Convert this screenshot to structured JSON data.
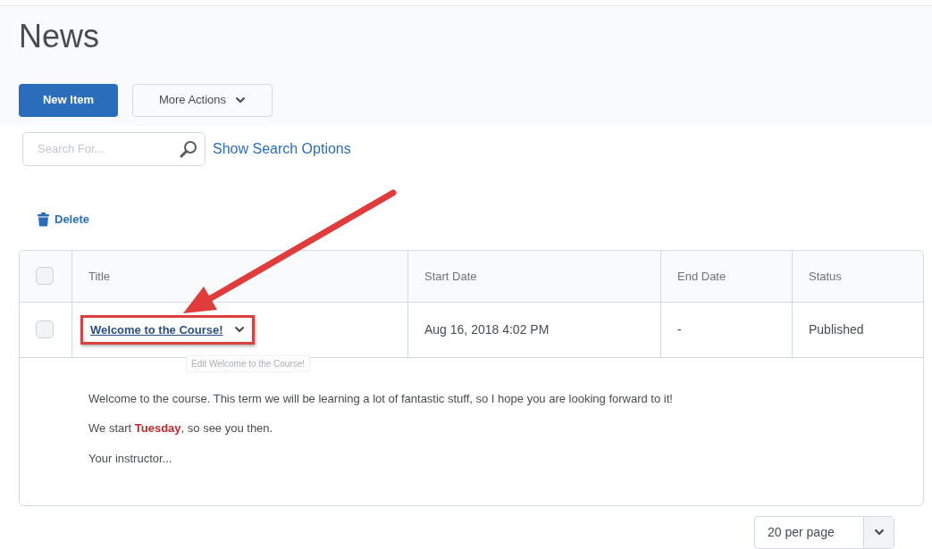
{
  "page_title": "News",
  "toolbar": {
    "primary_button": "New Item",
    "menu_button": "More Actions"
  },
  "search": {
    "placeholder": "Search For...",
    "options_link": "Show Search Options"
  },
  "bulk_action": "Delete",
  "table": {
    "select_all_checked": false,
    "columns": [
      "Title",
      "Start Date",
      "End Date",
      "Status"
    ],
    "rows": [
      {
        "checked": false,
        "title": "Welcome to the Course!",
        "start_date": "Aug 16, 2018 4:02 PM",
        "end_date": "-",
        "status": "Published",
        "tooltip": "Edit Welcome to the Course!",
        "highlighted": true,
        "body": [
          "Welcome to the course.  This term we will be learning a lot of fantastic stuff, so I hope you are looking forward to it!",
          "We start **Tuesday**, so see you then.",
          "Your instructor..."
        ]
      }
    ]
  },
  "pagination": {
    "page_size": "20 per page"
  },
  "annotation": {
    "kind": "arrow"
  }
}
